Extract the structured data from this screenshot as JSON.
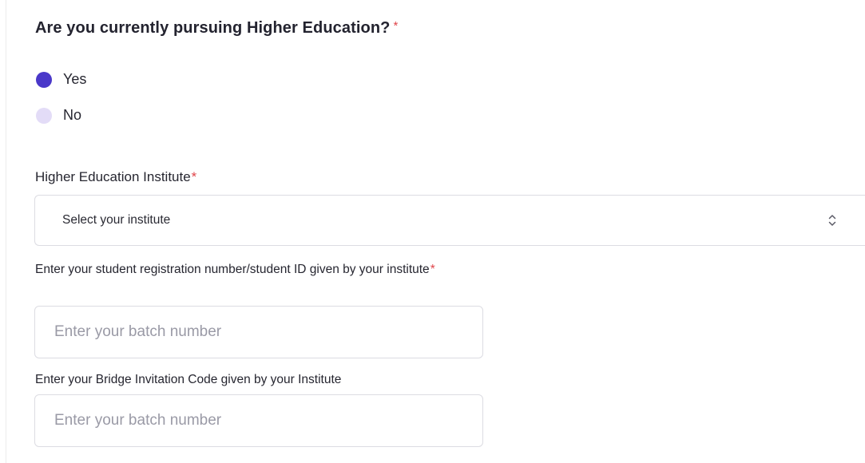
{
  "question": {
    "text": "Are you currently pursuing Higher Education?",
    "required_mark": "*"
  },
  "options": [
    {
      "label": "Yes",
      "selected": true
    },
    {
      "label": "No",
      "selected": false
    }
  ],
  "institute": {
    "label": "Higher Education Institute",
    "required_mark": "*",
    "selected_text": "Select your institute",
    "icon": "chevron-up-down-icon"
  },
  "registration": {
    "label": "Enter your student registration number/student ID given by your institute",
    "required_mark": "*",
    "placeholder": "Enter your batch number",
    "value": ""
  },
  "bridge": {
    "label": "Enter your Bridge Invitation Code given by your Institute",
    "placeholder": "Enter your batch number",
    "value": ""
  },
  "colors": {
    "accent": "#4a38c9",
    "radio_unselected": "#e3dcf7",
    "required": "#e0454a"
  }
}
